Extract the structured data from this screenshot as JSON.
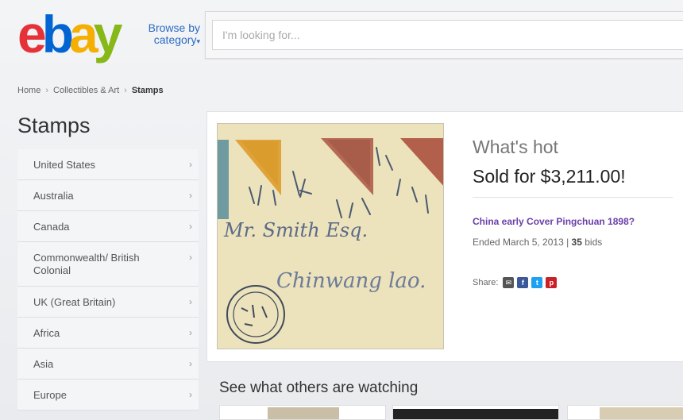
{
  "header": {
    "logo": [
      "e",
      "b",
      "a",
      "y"
    ],
    "browse_label": "Browse by",
    "browse_label2": "category",
    "search": {
      "placeholder": "I'm looking for..."
    }
  },
  "breadcrumb": [
    "Home",
    "Collectibles & Art",
    "Stamps"
  ],
  "sidebar": {
    "title": "Stamps",
    "items": [
      {
        "label": "United States"
      },
      {
        "label": "Australia"
      },
      {
        "label": "Canada"
      },
      {
        "label": "Commonwealth/ British Colonial"
      },
      {
        "label": "UK (Great Britain)"
      },
      {
        "label": "Africa"
      },
      {
        "label": "Asia"
      },
      {
        "label": "Europe"
      }
    ]
  },
  "hot": {
    "label": "What's hot",
    "price": "Sold for $3,211.00!",
    "item_title": "China early Cover Pingchuan 1898?",
    "ended": "Ended March 5, 2013 |",
    "bids_count": "35",
    "bids_suffix": "bids",
    "share_label": "Share:",
    "envelope_text1": "Mr. Smith Esq.",
    "envelope_text2": "Chinwang lao."
  },
  "watching": {
    "title": "See what others are watching"
  },
  "colors": {
    "logo_e": "#e53238",
    "logo_b": "#0064d2",
    "logo_a": "#f5af02",
    "logo_y": "#86b817",
    "link": "#2b6cc4",
    "item_link": "#6a3fa8"
  },
  "icons": [
    "chevron-right-icon",
    "email-icon",
    "facebook-icon",
    "twitter-icon",
    "pinterest-icon",
    "caret-down-icon"
  ]
}
